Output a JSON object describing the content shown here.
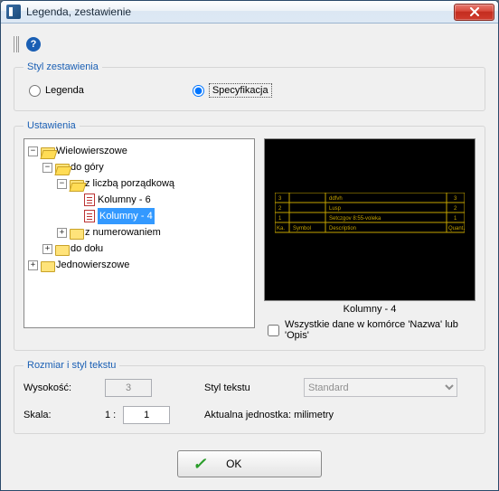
{
  "window": {
    "title": "Legenda, zestawienie"
  },
  "help": {
    "symbol": "?"
  },
  "style_group": {
    "legend": "Styl zestawienia",
    "option_legenda": "Legenda",
    "option_specyfikacja": "Specyfikacja",
    "selected": "specyfikacja"
  },
  "settings_group": {
    "legend": "Ustawienia",
    "tree": {
      "wielowierszowe": "Wielowierszowe",
      "do_gory": "do góry",
      "z_liczba": "z liczbą porządkową",
      "kolumny6": "Kolumny - 6",
      "kolumny4": "Kolumny - 4",
      "z_numerowaniem": "z numerowaniem",
      "do_dolu": "do dołu",
      "jednowierszowe": "Jednowierszowe"
    },
    "preview_caption": "Kolumny - 4",
    "checkbox_label": "Wszystkie dane w komórce 'Nazwa' lub 'Opis'"
  },
  "size_group": {
    "legend": "Rozmiar i styl tekstu",
    "height_label": "Wysokość:",
    "height_value": "3",
    "scale_label": "Skala:",
    "scale_prefix": "1 :",
    "scale_value": "1",
    "textstyle_label": "Styl tekstu",
    "textstyle_value": "Standard",
    "unit_label": "Aktualna jednostka: milimetry"
  },
  "buttons": {
    "ok": "OK"
  },
  "preview_rows": [
    {
      "c1": "3",
      "c2": "ddfvh",
      "c3": "",
      "c4": "3"
    },
    {
      "c1": "2",
      "c2": "Lusp",
      "c3": "",
      "c4": "2"
    },
    {
      "c1": "1",
      "c2": "Setczgov 8:55-voleka",
      "c3": "",
      "c4": "1"
    },
    {
      "c1": "Ka.",
      "c2": "Symbol",
      "c3": "Description",
      "c4": "Quant."
    }
  ]
}
